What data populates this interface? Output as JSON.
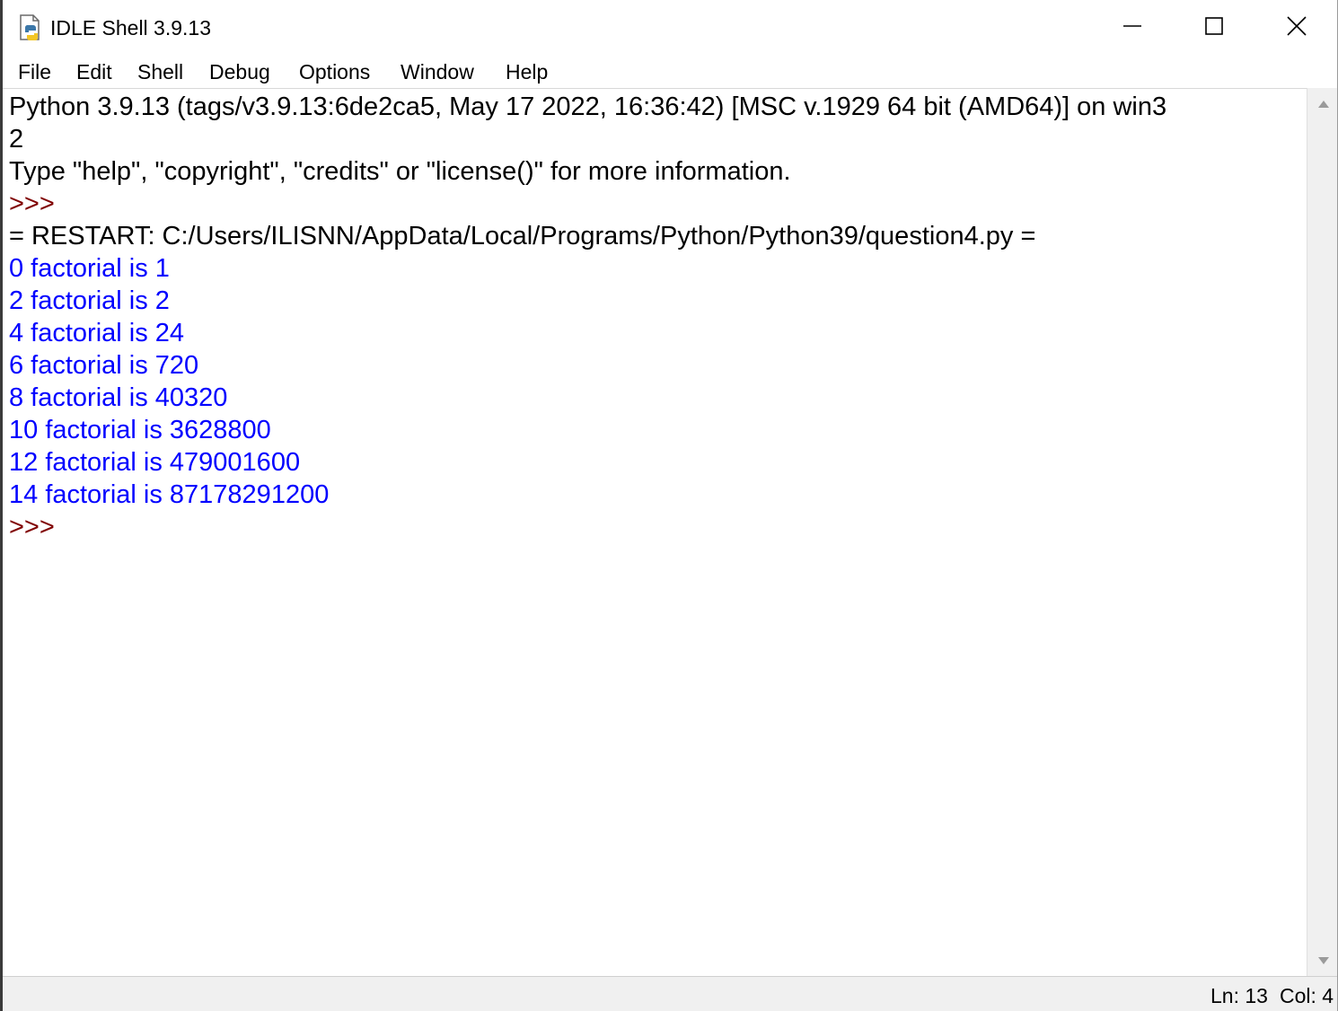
{
  "window": {
    "title": "IDLE Shell 3.9.13",
    "icon": "python-file-icon",
    "controls": {
      "minimize": "minimize-icon",
      "maximize": "maximize-icon",
      "close": "close-icon"
    }
  },
  "menu": {
    "items": [
      "File",
      "Edit",
      "Shell",
      "Debug",
      "Options",
      "Window",
      "Help"
    ]
  },
  "shell": {
    "banner_line1": "Python 3.9.13 (tags/v3.9.13:6de2ca5, May 17 2022, 16:36:42) [MSC v.1929 64 bit (AMD64)] on win3",
    "banner_line2": "2",
    "banner_line3": "Type \"help\", \"copyright\", \"credits\" or \"license()\" for more information.",
    "prompt": ">>>",
    "restart_line": "= RESTART: C:/Users/ILISNN/AppData/Local/Programs/Python/Python39/question4.py =",
    "output_lines": [
      "0 factorial is 1",
      "2 factorial is 2",
      "4 factorial is 24",
      "6 factorial is 720",
      "8 factorial is 40320",
      "10 factorial is 3628800",
      "12 factorial is 479001600",
      "14 factorial is 87178291200"
    ],
    "final_prompt": ">>>"
  },
  "colors": {
    "output": "#0000ff",
    "prompt": "#800000",
    "text": "#000000"
  },
  "status": {
    "ln": "Ln: 13",
    "col": "Col: 4"
  }
}
